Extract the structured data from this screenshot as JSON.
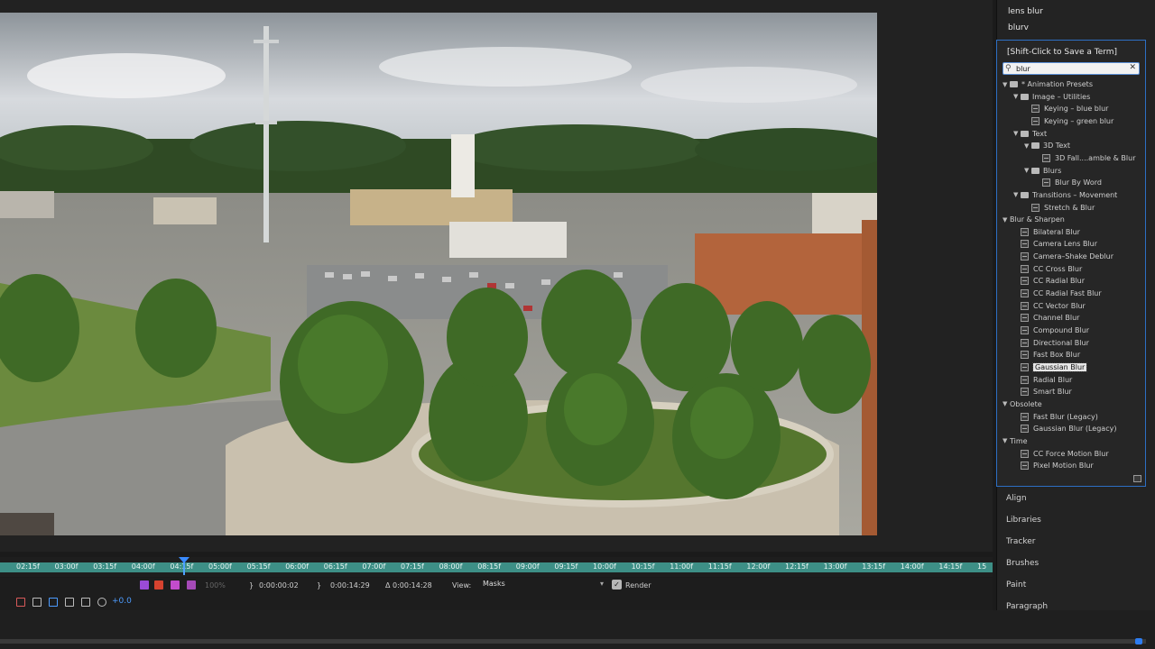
{
  "history_terms": [
    "lens blur",
    "blurv"
  ],
  "effects_presets": {
    "save_hint": "[Shift-Click to Save a Term]",
    "search_value": "blur",
    "search_clear_icon": "close-icon",
    "tree": [
      {
        "label": "* Animation Presets",
        "level": 0,
        "kind": "folder-open"
      },
      {
        "label": "Image – Utilities",
        "level": 1,
        "kind": "folder"
      },
      {
        "label": "Keying – blue blur",
        "level": 2,
        "kind": "preset"
      },
      {
        "label": "Keying – green blur",
        "level": 2,
        "kind": "preset"
      },
      {
        "label": "Text",
        "level": 1,
        "kind": "folder"
      },
      {
        "label": "3D Text",
        "level": 2,
        "kind": "folder"
      },
      {
        "label": "3D Fall....amble & Blur",
        "level": 3,
        "kind": "preset"
      },
      {
        "label": "Blurs",
        "level": 2,
        "kind": "folder"
      },
      {
        "label": "Blur By Word",
        "level": 3,
        "kind": "preset"
      },
      {
        "label": "Transitions – Movement",
        "level": 1,
        "kind": "folder"
      },
      {
        "label": "Stretch & Blur",
        "level": 2,
        "kind": "preset"
      },
      {
        "label": "Blur & Sharpen",
        "level": 0,
        "kind": "category"
      },
      {
        "label": "Bilateral Blur",
        "level": 1,
        "kind": "effect"
      },
      {
        "label": "Camera Lens Blur",
        "level": 1,
        "kind": "effect"
      },
      {
        "label": "Camera–Shake Deblur",
        "level": 1,
        "kind": "effect"
      },
      {
        "label": "CC Cross Blur",
        "level": 1,
        "kind": "effect"
      },
      {
        "label": "CC Radial Blur",
        "level": 1,
        "kind": "effect"
      },
      {
        "label": "CC Radial Fast Blur",
        "level": 1,
        "kind": "effect"
      },
      {
        "label": "CC Vector Blur",
        "level": 1,
        "kind": "effect"
      },
      {
        "label": "Channel Blur",
        "level": 1,
        "kind": "effect"
      },
      {
        "label": "Compound Blur",
        "level": 1,
        "kind": "effect"
      },
      {
        "label": "Directional Blur",
        "level": 1,
        "kind": "effect"
      },
      {
        "label": "Fast Box Blur",
        "level": 1,
        "kind": "effect"
      },
      {
        "label": "Gaussian Blur",
        "level": 1,
        "kind": "effect",
        "selected": true
      },
      {
        "label": "Radial Blur",
        "level": 1,
        "kind": "effect"
      },
      {
        "label": "Smart Blur",
        "level": 1,
        "kind": "effect"
      },
      {
        "label": "Obsolete",
        "level": 0,
        "kind": "category"
      },
      {
        "label": "Fast Blur (Legacy)",
        "level": 1,
        "kind": "effect"
      },
      {
        "label": "Gaussian Blur (Legacy)",
        "level": 1,
        "kind": "effect"
      },
      {
        "label": "Time",
        "level": 0,
        "kind": "category"
      },
      {
        "label": "CC Force Motion Blur",
        "level": 1,
        "kind": "effect"
      },
      {
        "label": "Pixel Motion Blur",
        "level": 1,
        "kind": "effect"
      }
    ]
  },
  "panels": [
    "Align",
    "Libraries",
    "Tracker",
    "Brushes",
    "Paint",
    "Paragraph"
  ],
  "timeline": {
    "ticks": [
      "02:15f",
      "03:00f",
      "03:15f",
      "04:00f",
      "04:15f",
      "05:00f",
      "05:15f",
      "06:00f",
      "06:15f",
      "07:00f",
      "07:15f",
      "08:00f",
      "08:15f",
      "09:00f",
      "09:15f",
      "10:00f",
      "10:15f",
      "11:00f",
      "11:15f",
      "12:00f",
      "12:15f",
      "13:00f",
      "13:15f",
      "14:00f",
      "14:15f",
      "15"
    ]
  },
  "viewer_controls": {
    "zoom": "100%",
    "current_time": "0:00:00:02",
    "out_time": "0:00:14:29",
    "duration": "Δ 0:00:14:28",
    "view_label": "View:",
    "view_value": "Masks",
    "render_label": "Render",
    "exposure": "+0.0"
  },
  "colors": {
    "accent": "#2d7cf0",
    "timeline_bar": "#3d8f86",
    "panel_bg": "#232323"
  }
}
